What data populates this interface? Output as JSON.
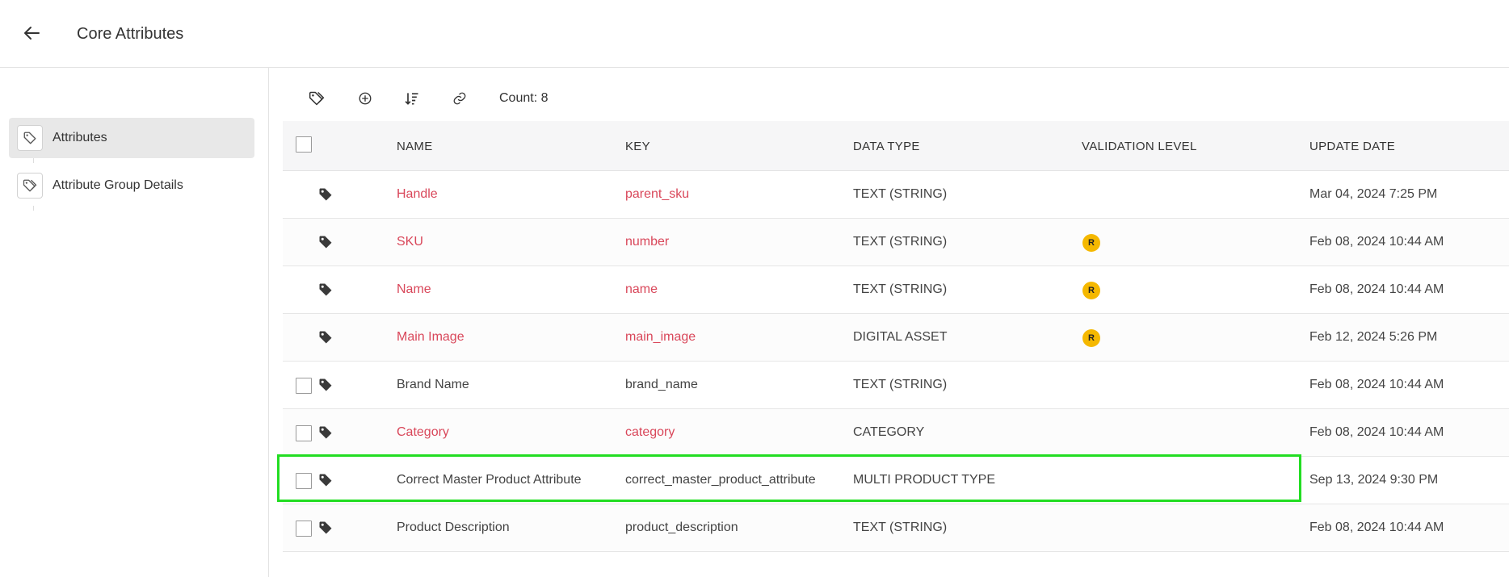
{
  "header": {
    "title": "Core Attributes"
  },
  "sidebar": {
    "items": [
      {
        "label": "Attributes",
        "active": true
      },
      {
        "label": "Attribute Group Details",
        "active": false
      }
    ]
  },
  "toolbar": {
    "count_label": "Count: 8",
    "buttons": [
      "tag-icon",
      "add-circle-icon",
      "sort-icon",
      "link-icon"
    ]
  },
  "table": {
    "columns": [
      "NAME",
      "KEY",
      "DATA TYPE",
      "VALIDATION LEVEL",
      "UPDATE DATE"
    ],
    "rows": [
      {
        "name": "Handle",
        "key": "parent_sku",
        "data_type": "TEXT (STRING)",
        "validation": "",
        "update_date": "Mar 04, 2024 7:25 PM",
        "core": true,
        "selectable": false
      },
      {
        "name": "SKU",
        "key": "number",
        "data_type": "TEXT (STRING)",
        "validation": "R",
        "update_date": "Feb 08, 2024 10:44 AM",
        "core": true,
        "selectable": false
      },
      {
        "name": "Name",
        "key": "name",
        "data_type": "TEXT (STRING)",
        "validation": "R",
        "update_date": "Feb 08, 2024 10:44 AM",
        "core": true,
        "selectable": false
      },
      {
        "name": "Main Image",
        "key": "main_image",
        "data_type": "DIGITAL ASSET",
        "validation": "R",
        "update_date": "Feb 12, 2024 5:26 PM",
        "core": true,
        "selectable": false
      },
      {
        "name": "Brand Name",
        "key": "brand_name",
        "data_type": "TEXT (STRING)",
        "validation": "",
        "update_date": "Feb 08, 2024 10:44 AM",
        "core": false,
        "selectable": true
      },
      {
        "name": "Category",
        "key": "category",
        "data_type": "CATEGORY",
        "validation": "",
        "update_date": "Feb 08, 2024 10:44 AM",
        "core": true,
        "selectable": true
      },
      {
        "name": "Correct Master Product Attribute",
        "key": "correct_master_product_attribute",
        "data_type": "MULTI PRODUCT TYPE",
        "validation": "",
        "update_date": "Sep 13, 2024 9:30 PM",
        "core": false,
        "selectable": true
      },
      {
        "name": "Product Description",
        "key": "product_description",
        "data_type": "TEXT (STRING)",
        "validation": "",
        "update_date": "Feb 08, 2024 10:44 AM",
        "core": false,
        "selectable": true
      }
    ]
  },
  "colors": {
    "core_name": "#d9475a",
    "badge": "#f5b800",
    "highlight": "#22dd22"
  }
}
